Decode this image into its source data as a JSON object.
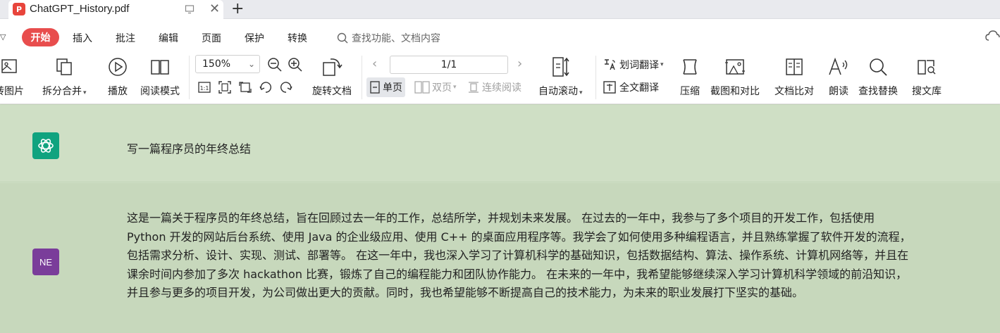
{
  "tab": {
    "title": "ChatGPT_History.pdf",
    "pdf_badge": "P"
  },
  "menu": {
    "items": [
      "开始",
      "插入",
      "批注",
      "编辑",
      "页面",
      "保护",
      "转换"
    ],
    "search_placeholder": "查找功能、文档内容"
  },
  "toolbar": {
    "to_image": "转图片",
    "split_merge": "拆分合并",
    "play": "播放",
    "reading_mode": "阅读模式",
    "zoom": "150%",
    "rotate_doc": "旋转文档",
    "page_indicator": "1/1",
    "single_page": "单页",
    "double_page": "双页",
    "continuous": "连续阅读",
    "auto_scroll": "自动滚动",
    "word_translate": "划词翻译",
    "full_translate": "全文翻译",
    "compress": "压缩",
    "screenshot_compare": "截图和对比",
    "doc_compare": "文档比对",
    "read_aloud": "朗读",
    "find_replace": "查找替换",
    "search_library": "搜文库"
  },
  "conversation": {
    "user_message": "写一篇程序员的年终总结",
    "assistant_avatar": "NE",
    "assistant_message": "这是一篇关于程序员的年终总结，旨在回顾过去一年的工作，总结所学，并规划未来发展。 在过去的一年中，我参与了多个项目的开发工作，包括使用 Python 开发的网站后台系统、使用 Java 的企业级应用、使用 C++ 的桌面应用程序等。我学会了如何使用多种编程语言，并且熟练掌握了软件开发的流程，包括需求分析、设计、实现、测试、部署等。 在这一年中，我也深入学习了计算机科学的基础知识，包括数据结构、算法、操作系统、计算机网络等，并且在课余时间内参加了多次 hackathon 比赛，锻炼了自己的编程能力和团队协作能力。 在未来的一年中，我希望能够继续深入学习计算机科学领域的前沿知识，并且参与更多的项目开发，为公司做出更大的贡献。同时，我也希望能够不断提高自己的技术能力，为未来的职业发展打下坚实的基础。"
  },
  "colors": {
    "accent": "#e84d4d",
    "content_bg": "#cfdfc5",
    "gpt_green": "#10a37f",
    "ne_purple": "#7a3d9a"
  }
}
